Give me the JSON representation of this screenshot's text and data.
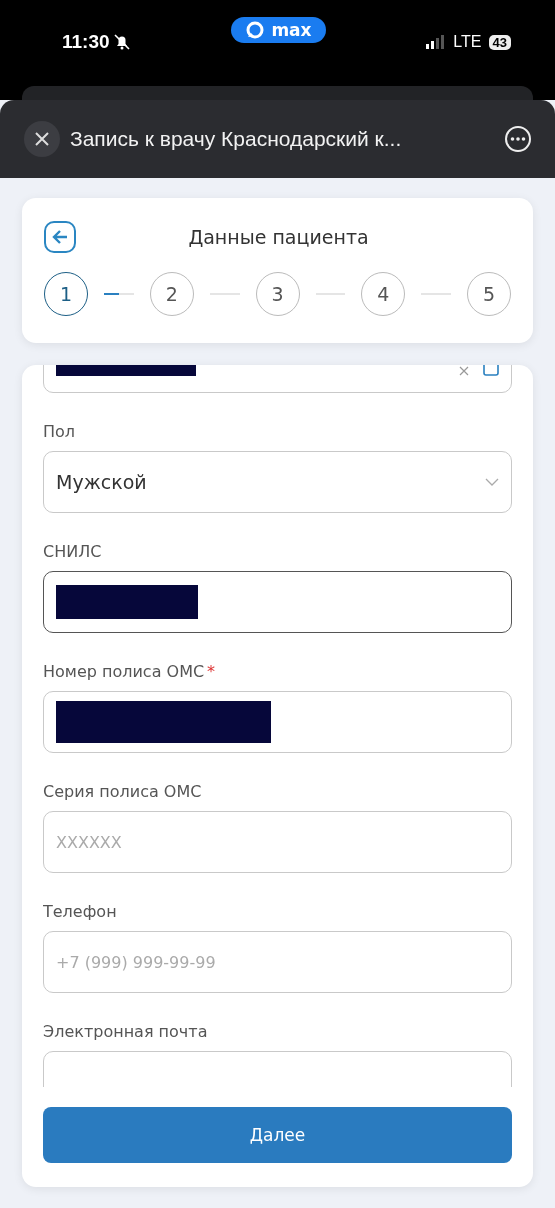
{
  "status_bar": {
    "time": "11:30",
    "silent": true,
    "app_pill": "max",
    "network": "LTE",
    "battery": "43"
  },
  "sheet": {
    "title": "Запись к врачу Краснодарский к..."
  },
  "header": {
    "title": "Данные пациента",
    "steps": [
      {
        "label": "1",
        "selected": true
      },
      {
        "label": "2",
        "selected": false
      },
      {
        "label": "3",
        "selected": false
      },
      {
        "label": "4",
        "selected": false
      },
      {
        "label": "5",
        "selected": false
      }
    ]
  },
  "fields": [
    {
      "kind": "date",
      "redacted": true,
      "focused": false
    },
    {
      "kind": "select",
      "label": "Пол",
      "value": "Мужской",
      "focused": false
    },
    {
      "kind": "text",
      "label": "СНИЛС",
      "redacted": true,
      "focused": true
    },
    {
      "kind": "text",
      "label": "Номер полиса ОМС",
      "required_mark": "*",
      "redacted": true,
      "focused": false
    },
    {
      "kind": "text",
      "label": "Серия полиса ОМС",
      "placeholder": "XXXXXX",
      "focused": false
    },
    {
      "kind": "text",
      "label": "Телефон",
      "placeholder": "+7 (999) 999-99-99",
      "focused": false
    },
    {
      "kind": "text",
      "label": "Электронная почта",
      "focused": false
    }
  ],
  "button": "Далее"
}
